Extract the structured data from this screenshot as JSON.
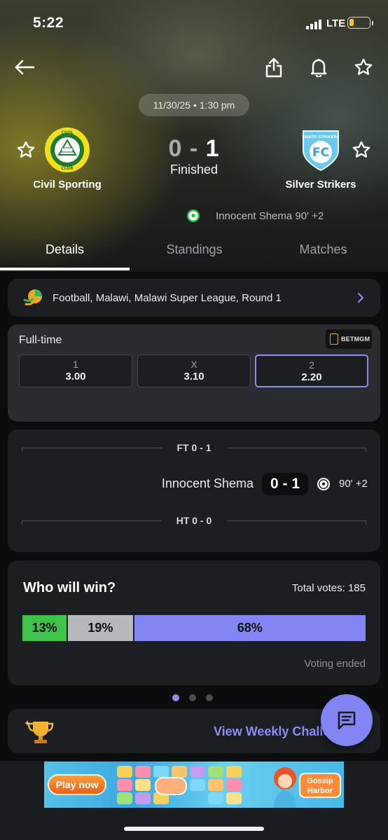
{
  "status_bar": {
    "time": "5:22",
    "network": "LTE"
  },
  "match": {
    "date": "11/30/25 • 1:30 pm",
    "home_team": "Civil Sporting",
    "away_team": "Silver Strikers",
    "score_home": "0",
    "score_sep": " - ",
    "score_away": "1",
    "state": "Finished",
    "scorer": "Innocent Shema 90' +2"
  },
  "tabs": [
    "Details",
    "Standings",
    "Matches"
  ],
  "league": {
    "label": "Football, Malawi, Malawi Super League, Round 1"
  },
  "odds": {
    "title": "Full-time",
    "bookmaker": "BETMGM",
    "options": [
      {
        "label": "1",
        "value": "3.00"
      },
      {
        "label": "X",
        "value": "3.10"
      },
      {
        "label": "2",
        "value": "2.20"
      }
    ]
  },
  "timeline": {
    "ft_label": "FT 0 - 1",
    "ht_label": "HT 0 - 0",
    "goal": {
      "player": "Innocent Shema",
      "score": "0 - 1",
      "minute": "90' +2"
    }
  },
  "poll": {
    "title": "Who will win?",
    "total_votes": "Total votes: 185",
    "segments": [
      {
        "label": "13%",
        "value": 13,
        "color": "#3ec24d"
      },
      {
        "label": "19%",
        "value": 19,
        "color": "#b6b8bd"
      },
      {
        "label": "68%",
        "value": 68,
        "color": "#8486f6"
      }
    ],
    "status": "Voting ended"
  },
  "challenge": {
    "label": "View Weekly Challe"
  },
  "ad": {
    "cta": "Play now",
    "brand": "Gossip Harbor"
  },
  "colors": {
    "accent": "#8c8ef8",
    "card": "#1c1e21",
    "background": "#0b0c0e"
  }
}
